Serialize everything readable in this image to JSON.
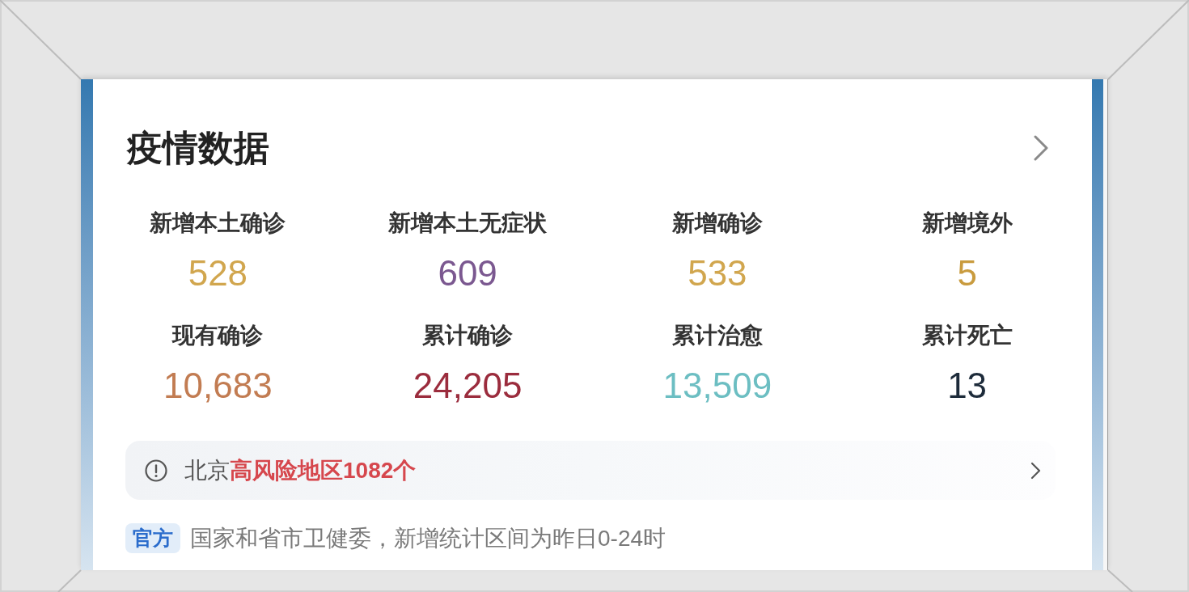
{
  "card": {
    "title": "疫情数据"
  },
  "stats": [
    {
      "label": "新增本土确诊",
      "value": "528",
      "color": "#d1a64e"
    },
    {
      "label": "新增本土无症状",
      "value": "609",
      "color": "#7b5890"
    },
    {
      "label": "新增确诊",
      "value": "533",
      "color": "#d1a64e"
    },
    {
      "label": "新增境外",
      "value": "5",
      "color": "#c99b3e"
    },
    {
      "label": "现有确诊",
      "value": "10,683",
      "color": "#c27c52"
    },
    {
      "label": "累计确诊",
      "value": "24,205",
      "color": "#9b2c3d"
    },
    {
      "label": "累计治愈",
      "value": "13,509",
      "color": "#6cbec2"
    },
    {
      "label": "累计死亡",
      "value": "13",
      "color": "#1d2b3a"
    }
  ],
  "alert": {
    "place": "北京",
    "highlight": "高风险地区1082个"
  },
  "source": {
    "badge": "官方",
    "text": "国家和省市卫健委，新增统计区间为昨日0-24时"
  }
}
